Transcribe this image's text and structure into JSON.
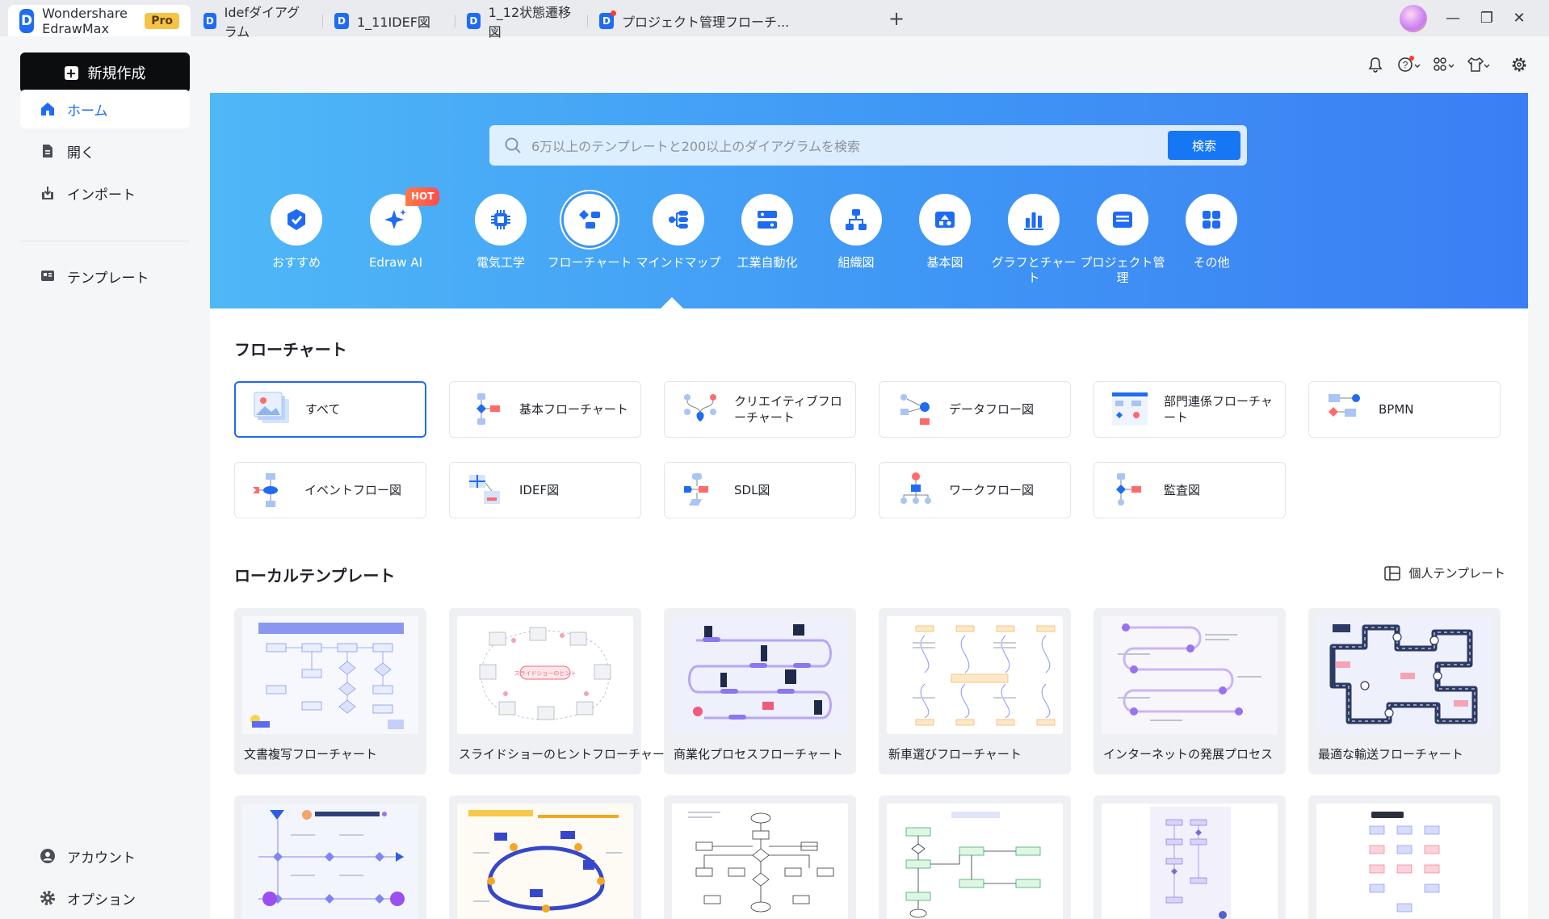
{
  "titlebar": {
    "app_name": "Wondershare EdrawMax",
    "pro_label": "Pro",
    "tabs": [
      {
        "label": "Idefダイアグラム"
      },
      {
        "label": "1_11IDEF図"
      },
      {
        "label": "1_12状態遷移図"
      },
      {
        "label": "プロジェクト管理フローチ..."
      }
    ],
    "new_tab": "+",
    "window_buttons": [
      "—",
      "❐",
      "✕"
    ]
  },
  "sidebar": {
    "new_button": "新規作成",
    "items": [
      {
        "label": "ホーム",
        "icon": "home-icon"
      },
      {
        "label": "開く",
        "icon": "open-file-icon"
      },
      {
        "label": "インポート",
        "icon": "import-icon"
      },
      {
        "label": "テンプレート",
        "icon": "template-icon"
      }
    ],
    "bottom_items": [
      {
        "label": "アカウント",
        "icon": "account-icon"
      },
      {
        "label": "オプション",
        "icon": "options-gear-icon"
      }
    ]
  },
  "hero": {
    "search_placeholder": "6万以上のテンプレートと200以上のダイアグラムを検索",
    "search_button": "検索",
    "hot_badge": "HOT",
    "categories": [
      {
        "label": "おすすめ"
      },
      {
        "label": "Edraw AI"
      },
      {
        "label": "電気工学"
      },
      {
        "label": "フローチャート"
      },
      {
        "label": "マインドマップ"
      },
      {
        "label": "工業自動化"
      },
      {
        "label": "組織図"
      },
      {
        "label": "基本図"
      },
      {
        "label": "グラフとチャート"
      },
      {
        "label": "プロジェクト管理"
      },
      {
        "label": "その他"
      }
    ]
  },
  "flowchart_section": {
    "title": "フローチャート",
    "types": [
      {
        "label": "すべて"
      },
      {
        "label": "基本フローチャート"
      },
      {
        "label": "クリエイティブフローチャート"
      },
      {
        "label": "データフロー図"
      },
      {
        "label": "部門連係フローチャート"
      },
      {
        "label": "BPMN"
      },
      {
        "label": "イベントフロー図"
      },
      {
        "label": "IDEF図"
      },
      {
        "label": "SDL図"
      },
      {
        "label": "ワークフロー図"
      },
      {
        "label": "監査図"
      }
    ]
  },
  "local_templates": {
    "title": "ローカルテンプレート",
    "personal_link": "個人テンプレート",
    "cards": [
      {
        "name": "文書複写フローチャート"
      },
      {
        "name": "スライドショーのヒントフローチャート"
      },
      {
        "name": "商業化プロセスフローチャート"
      },
      {
        "name": "新車選びフローチャート"
      },
      {
        "name": "インターネットの発展プロセス"
      },
      {
        "name": "最適な輸送フローチャート"
      }
    ]
  }
}
